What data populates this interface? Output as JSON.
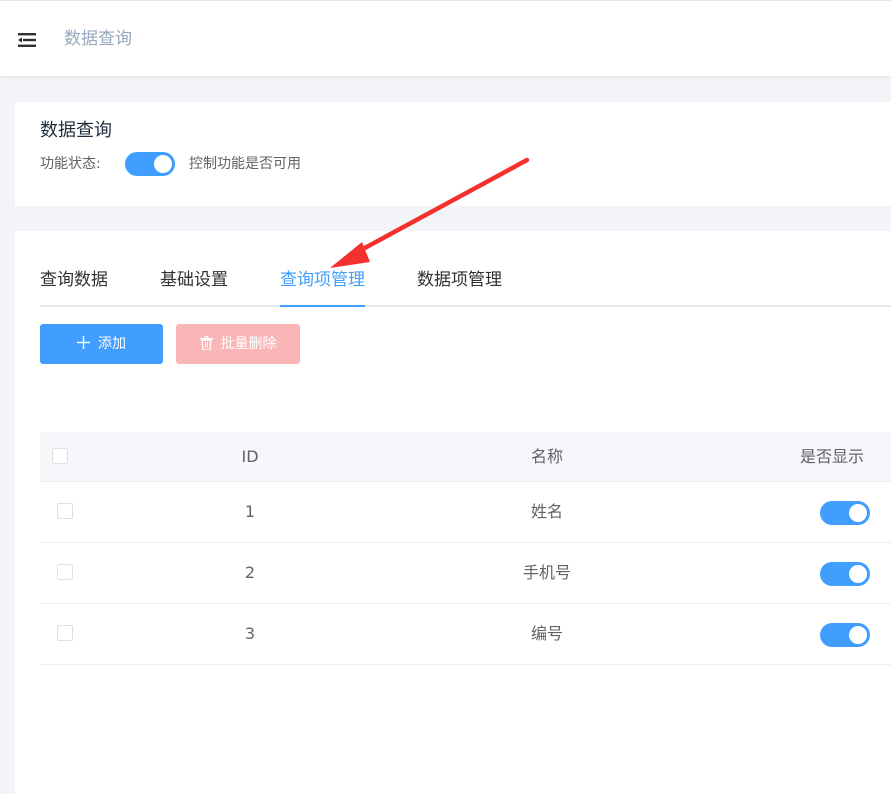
{
  "header": {
    "breadcrumb": "数据查询",
    "menu_icon": "menu-fold-icon"
  },
  "status_card": {
    "title": "数据查询",
    "status_label": "功能状态:",
    "status_on": true,
    "status_desc": "控制功能是否可用"
  },
  "tabs": [
    {
      "label": "查询数据",
      "active": false
    },
    {
      "label": "基础设置",
      "active": false
    },
    {
      "label": "查询项管理",
      "active": true
    },
    {
      "label": "数据项管理",
      "active": false
    }
  ],
  "toolbar": {
    "add_label": "添加",
    "add_icon": "plus-icon",
    "batch_delete_label": "批量删除",
    "batch_delete_icon": "trash-icon",
    "batch_delete_enabled": false
  },
  "table": {
    "columns": [
      "ID",
      "名称",
      "是否显示"
    ],
    "rows": [
      {
        "id": "1",
        "name": "姓名",
        "show": true
      },
      {
        "id": "2",
        "name": "手机号",
        "show": true
      },
      {
        "id": "3",
        "name": "编号",
        "show": true
      }
    ]
  },
  "colors": {
    "primary": "#409eff",
    "danger_disabled": "#fab6b6",
    "annotation_arrow": "#f5302e"
  }
}
